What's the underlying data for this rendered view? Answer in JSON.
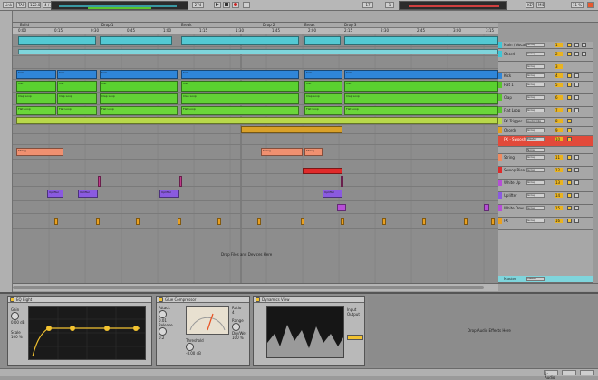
{
  "topbar": {
    "link": "Link",
    "tap": "TAP",
    "tempo": "122.00",
    "signature": "4 / 4",
    "metro": "1 Bar",
    "position": "274",
    "loop_start": "17",
    "loop_len": "1",
    "key": "KEY",
    "midi": "MIDI",
    "cpu": "11 %"
  },
  "ruler": {
    "locators": [
      "Build",
      "Drop 1",
      "Break",
      "Drop 2",
      "Break",
      "Drop 3"
    ],
    "times": [
      "0:00",
      "0:15",
      "0:30",
      "0:45",
      "1:00",
      "1:15",
      "1:30",
      "1:45",
      "2:00",
      "2:15",
      "2:30",
      "2:45",
      "3:00",
      "3:15"
    ]
  },
  "arrangement": {
    "drop_hint": "Drop Files and Devices Here",
    "clips": {
      "kick": "Kick",
      "hat": "Hat",
      "clap": "Clap Loop",
      "flat": "Flat Loop",
      "string": "String",
      "uplifter": "Uplifter",
      "fx": "FX"
    }
  },
  "tracks": [
    {
      "name": "Main / Vocal",
      "sel": "Group",
      "num": "1",
      "color": "#3fc6d6"
    },
    {
      "name": "Chord",
      "sel": "Group",
      "num": "2",
      "color": "#3fc6d6"
    },
    {
      "name": "",
      "sel": "Group",
      "num": "3",
      "color": "#b5b5b5"
    },
    {
      "name": "Kick",
      "sel": "Group",
      "num": "4",
      "color": "#2f86d9"
    },
    {
      "name": "Hat 1",
      "sel": "Group",
      "num": "5",
      "color": "#58c52c"
    },
    {
      "name": "Clap",
      "sel": "Group",
      "num": "6",
      "color": "#58c52c"
    },
    {
      "name": "Flat Loop",
      "sel": "Group",
      "num": "7",
      "color": "#58c52c"
    },
    {
      "name": "FX Trigger",
      "sel": "Audio Clip",
      "num": "8",
      "color": "#b8d84a"
    },
    {
      "name": "Chords",
      "sel": "Group",
      "num": "9",
      "color": "#e0a020"
    },
    {
      "name": "FX - Swoosh",
      "sel": "Master",
      "num": "10",
      "color": "#e02a2a"
    },
    {
      "name": "",
      "sel": "None",
      "num": "",
      "color": "#b5b5b5"
    },
    {
      "name": "String",
      "sel": "Group",
      "num": "11",
      "color": "#f08a60"
    },
    {
      "name": "Swoop Rise",
      "sel": "Group",
      "num": "12",
      "color": "#e02a2a"
    },
    {
      "name": "White Up",
      "sel": "Group",
      "num": "13",
      "color": "#b64fd6"
    },
    {
      "name": "Uplifter",
      "sel": "Group",
      "num": "14",
      "color": "#8a5ae0"
    },
    {
      "name": "White Dow",
      "sel": "Group",
      "num": "15",
      "color": "#b64fd6"
    },
    {
      "name": "FX",
      "sel": "Group",
      "num": "16",
      "color": "#e9a020"
    },
    {
      "name": "Master",
      "sel": "Master",
      "num": "",
      "color": "#3fc6d6"
    }
  ],
  "devices": {
    "eq": {
      "title": "EQ Eight",
      "labels": [
        "Gain",
        "Scale",
        "Adapt. Q"
      ],
      "values": [
        "0.00 dB",
        "100 %",
        "1"
      ]
    },
    "comp": {
      "title": "Glue Compressor",
      "labels": [
        "Attack",
        "Release",
        "Ratio",
        "Threshold",
        "Makeup",
        "Range",
        "Dry/Wet"
      ],
      "values": [
        "0.01",
        "0.2",
        "4",
        "-8.00 dB",
        "0.00 dB",
        "inf dB",
        "100 %"
      ]
    },
    "dyn": {
      "title": "Dynamics View",
      "labels": [
        "Input",
        "Output",
        "Gain"
      ],
      "values": [
        "0.00 dB",
        "0.00 dB",
        "0.00 dB"
      ]
    },
    "drop_hint": "Drop Audio Effects Here"
  },
  "statusbar": {
    "track": "1-Audio"
  },
  "colors": {
    "accent": "#f2c230",
    "blue": "#2f86d9",
    "green": "#58c52c",
    "red": "#e02a2a",
    "purple": "#8a5ae0",
    "cyan": "#3fc6d6"
  },
  "icons": [
    "play-icon",
    "stop-icon",
    "record-icon",
    "loop-icon",
    "metronome-icon",
    "power-icon",
    "fold-icon"
  ]
}
